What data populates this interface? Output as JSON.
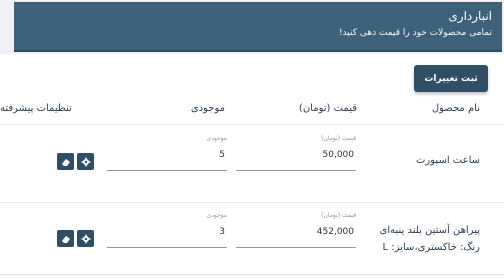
{
  "header": {
    "title": "انبارداری",
    "subtitle": "تمامی محصولات خود را قیمت دهی کنید!"
  },
  "toolbar": {
    "save_label": "ثبت تغییرات"
  },
  "table": {
    "headers": {
      "name": "نام محصول",
      "price": "قیمت (تومان)",
      "stock": "موجودی",
      "advanced": "تنظیمات پیشرفته"
    },
    "rows": [
      {
        "name_line1": "ساعت اسپورت",
        "name_line2": "",
        "price_label": "قیمت (تومان)",
        "price_value": "50,000",
        "stock_label": "موجودی",
        "stock_value": "5"
      },
      {
        "name_line1": "پیراهن آستین بلند پنبه‌ای",
        "name_line2": "رنگ: خاکستری،سایز: L",
        "price_label": "قیمت (تومان)",
        "price_value": "452,000",
        "stock_label": "موجودی",
        "stock_value": "3"
      }
    ]
  },
  "icons": {
    "settings": "gear-icon",
    "eraser": "eraser-icon"
  },
  "colors": {
    "header_bg": "#3d6178",
    "button_bg": "#2f4f67"
  }
}
